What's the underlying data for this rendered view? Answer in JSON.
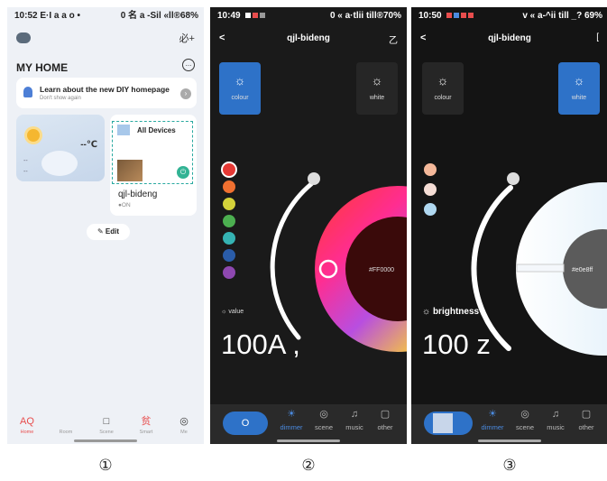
{
  "colors": {
    "accent": "#2e72c8",
    "home_red": "#e84d4d",
    "teal": "#32b394",
    "dark_bg": "#1a1a1a"
  },
  "captions": [
    "①",
    "②",
    "③"
  ],
  "screen1": {
    "status": {
      "time": "10:52 E·I a a o •",
      "right": "0 名 a -Sil «ll®68%"
    },
    "add_label": "必+",
    "title": "MY HOME",
    "more_icon": "...",
    "banner": {
      "title": "Learn about the new DIY homepage",
      "subtitle": "Don't show again"
    },
    "weather": {
      "temp": "--℃",
      "line1": "--",
      "line2": "--"
    },
    "all_devices": "All Devices",
    "device": {
      "name": "qjl-bideng",
      "status": "●ON"
    },
    "edit_label": "Edit",
    "tabs": [
      {
        "icon": "AQ",
        "label": "Home"
      },
      {
        "icon": "",
        "label": "Room"
      },
      {
        "icon": "□",
        "label": "Scene"
      },
      {
        "icon": "贫",
        "label": "Smart"
      },
      {
        "icon": "◎",
        "label": "Me"
      }
    ]
  },
  "screen2": {
    "status": {
      "time": "10:49",
      "right": "0 « a·tlii till®70%"
    },
    "back": "<",
    "title": "qjl-bideng",
    "edit_icon": "乙",
    "modes": [
      {
        "label": "colour"
      },
      {
        "label": "white"
      }
    ],
    "swatches": [
      "#e53935",
      "#f07030",
      "#d4d23a",
      "#4caf50",
      "#35b3b3",
      "#2a5ca8",
      "#8e48b0"
    ],
    "hex": "#FF0000",
    "value_label": "value",
    "big_value": "100A ,",
    "onoff": "O",
    "tabs": [
      {
        "icon": "☀",
        "label": "dimmer"
      },
      {
        "icon": "◎",
        "label": "scene"
      },
      {
        "icon": "♫",
        "label": "music"
      },
      {
        "icon": "▢",
        "label": "other"
      }
    ]
  },
  "screen3": {
    "status": {
      "time": "10:50",
      "right": "v « a-^ii till _? 69%"
    },
    "back": "<",
    "title": "qjl-bideng",
    "edit_icon": "[",
    "modes": [
      {
        "label": "colour"
      },
      {
        "label": "white"
      }
    ],
    "swatches": [
      "#f4b89a",
      "#f5ddd5",
      "#b0d8f0"
    ],
    "hex": "#e0e8ff",
    "brightness_label": "brightness",
    "big_value": "100 z",
    "tabs": [
      {
        "icon": "☀",
        "label": "dimmer"
      },
      {
        "icon": "◎",
        "label": "scene"
      },
      {
        "icon": "♫",
        "label": "music"
      },
      {
        "icon": "▢",
        "label": "other"
      }
    ]
  }
}
